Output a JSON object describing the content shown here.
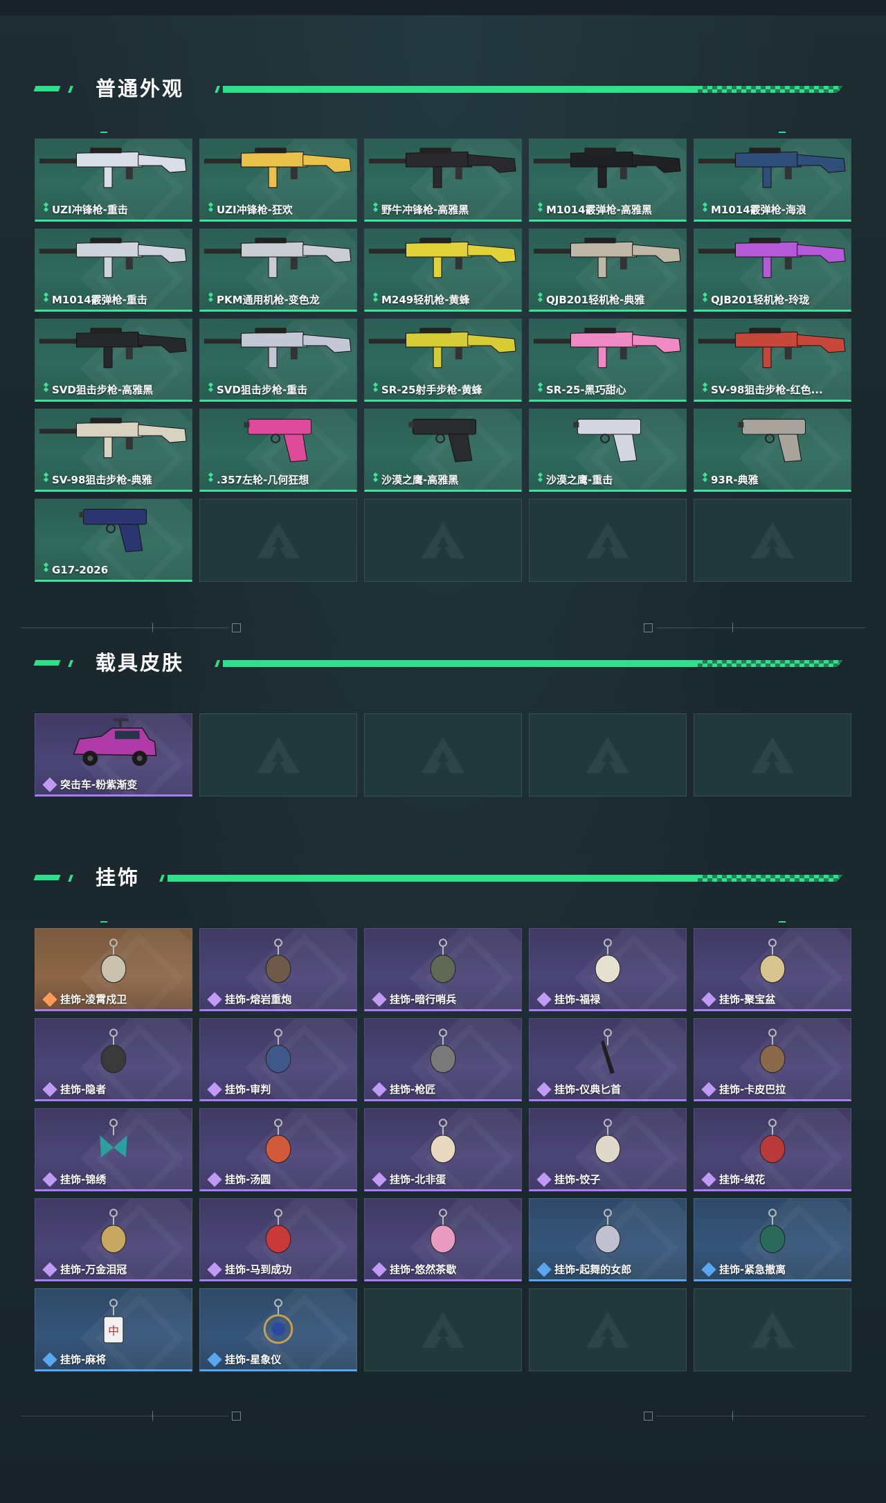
{
  "colors": {
    "accent": "#2ee08a",
    "green_rarity": "#3ee39a",
    "purple_rarity": "#a77ff0",
    "blue_rarity": "#5aa7f0",
    "orange_card": "#8d6748"
  },
  "sections": {
    "weapons": {
      "title": "普通外观",
      "items": [
        {
          "label": "UZI冲锋枪-重击",
          "rarity": "green",
          "icon": "smg-icon"
        },
        {
          "label": "UZI冲锋枪-狂欢",
          "rarity": "green",
          "icon": "smg-icon"
        },
        {
          "label": "野牛冲锋枪-高雅黑",
          "rarity": "green",
          "icon": "smg-icon"
        },
        {
          "label": "M1014霰弹枪-高雅黑",
          "rarity": "green",
          "icon": "shotgun-icon"
        },
        {
          "label": "M1014霰弹枪-海浪",
          "rarity": "green",
          "icon": "shotgun-icon"
        },
        {
          "label": "M1014霰弹枪-重击",
          "rarity": "green",
          "icon": "shotgun-icon"
        },
        {
          "label": "PKM通用机枪-变色龙",
          "rarity": "green",
          "icon": "machine-gun-icon"
        },
        {
          "label": "M249轻机枪-黄蜂",
          "rarity": "green",
          "icon": "machine-gun-icon"
        },
        {
          "label": "QJB201轻机枪-典雅",
          "rarity": "green",
          "icon": "machine-gun-icon"
        },
        {
          "label": "QJB201轻机枪-玲珑",
          "rarity": "green",
          "icon": "machine-gun-icon"
        },
        {
          "label": "SVD狙击步枪-高雅黑",
          "rarity": "green",
          "icon": "sniper-rifle-icon"
        },
        {
          "label": "SVD狙击步枪-重击",
          "rarity": "green",
          "icon": "sniper-rifle-icon"
        },
        {
          "label": "SR-25射手步枪-黄蜂",
          "rarity": "green",
          "icon": "marksman-rifle-icon"
        },
        {
          "label": "SR-25-黑巧甜心",
          "rarity": "green",
          "icon": "marksman-rifle-icon"
        },
        {
          "label": "SV-98狙击步枪-红色...",
          "rarity": "green",
          "icon": "sniper-rifle-icon"
        },
        {
          "label": "SV-98狙击步枪-典雅",
          "rarity": "green",
          "icon": "sniper-rifle-icon"
        },
        {
          "label": ".357左轮-几何狂想",
          "rarity": "green",
          "icon": "revolver-icon"
        },
        {
          "label": "沙漠之鹰-高雅黑",
          "rarity": "green",
          "icon": "pistol-icon"
        },
        {
          "label": "沙漠之鹰-重击",
          "rarity": "green",
          "icon": "pistol-icon"
        },
        {
          "label": "93R-典雅",
          "rarity": "green",
          "icon": "pistol-icon"
        },
        {
          "label": "G17-2026",
          "rarity": "green",
          "icon": "pistol-icon"
        }
      ]
    },
    "vehicles": {
      "title": "载具皮肤",
      "items": [
        {
          "label": "突击车-粉紫渐变",
          "rarity": "purple",
          "icon": "assault-vehicle-icon"
        }
      ]
    },
    "charms": {
      "title": "挂饰",
      "items": [
        {
          "label": "挂饰-凌霄戍卫",
          "rarity": "orange",
          "icon": "charm-icon"
        },
        {
          "label": "挂饰-熔岩重炮",
          "rarity": "purple",
          "icon": "charm-icon"
        },
        {
          "label": "挂饰-暗行哨兵",
          "rarity": "purple",
          "icon": "charm-icon"
        },
        {
          "label": "挂饰-福禄",
          "rarity": "purple",
          "icon": "charm-icon"
        },
        {
          "label": "挂饰-聚宝盆",
          "rarity": "purple",
          "icon": "charm-icon"
        },
        {
          "label": "挂饰-隐者",
          "rarity": "purple",
          "icon": "charm-icon"
        },
        {
          "label": "挂饰-审判",
          "rarity": "purple",
          "icon": "charm-icon"
        },
        {
          "label": "挂饰-枪匠",
          "rarity": "purple",
          "icon": "charm-icon"
        },
        {
          "label": "挂饰-仪典匕首",
          "rarity": "purple",
          "icon": "dagger-charm-icon"
        },
        {
          "label": "挂饰-卡皮巴拉",
          "rarity": "purple",
          "icon": "charm-icon"
        },
        {
          "label": "挂饰-锦绣",
          "rarity": "purple",
          "icon": "butterfly-charm-icon"
        },
        {
          "label": "挂饰-汤圆",
          "rarity": "purple",
          "icon": "charm-icon"
        },
        {
          "label": "挂饰-北非蛋",
          "rarity": "purple",
          "icon": "charm-icon"
        },
        {
          "label": "挂饰-饺子",
          "rarity": "purple",
          "icon": "charm-icon"
        },
        {
          "label": "挂饰-绒花",
          "rarity": "purple",
          "icon": "flower-charm-icon"
        },
        {
          "label": "挂饰-万金泪冠",
          "rarity": "purple",
          "icon": "charm-icon"
        },
        {
          "label": "挂饰-马到成功",
          "rarity": "purple",
          "icon": "horse-charm-icon"
        },
        {
          "label": "挂饰-悠然茶歇",
          "rarity": "purple",
          "icon": "cupcake-charm-icon"
        },
        {
          "label": "挂饰-起舞的女郎",
          "rarity": "blue",
          "icon": "charm-icon"
        },
        {
          "label": "挂饰-紧急撤离",
          "rarity": "blue",
          "icon": "charm-icon"
        },
        {
          "label": "挂饰-麻将",
          "rarity": "blue",
          "icon": "mahjong-charm-icon"
        },
        {
          "label": "挂饰-星象仪",
          "rarity": "blue",
          "icon": "astrolabe-charm-icon"
        }
      ]
    }
  }
}
